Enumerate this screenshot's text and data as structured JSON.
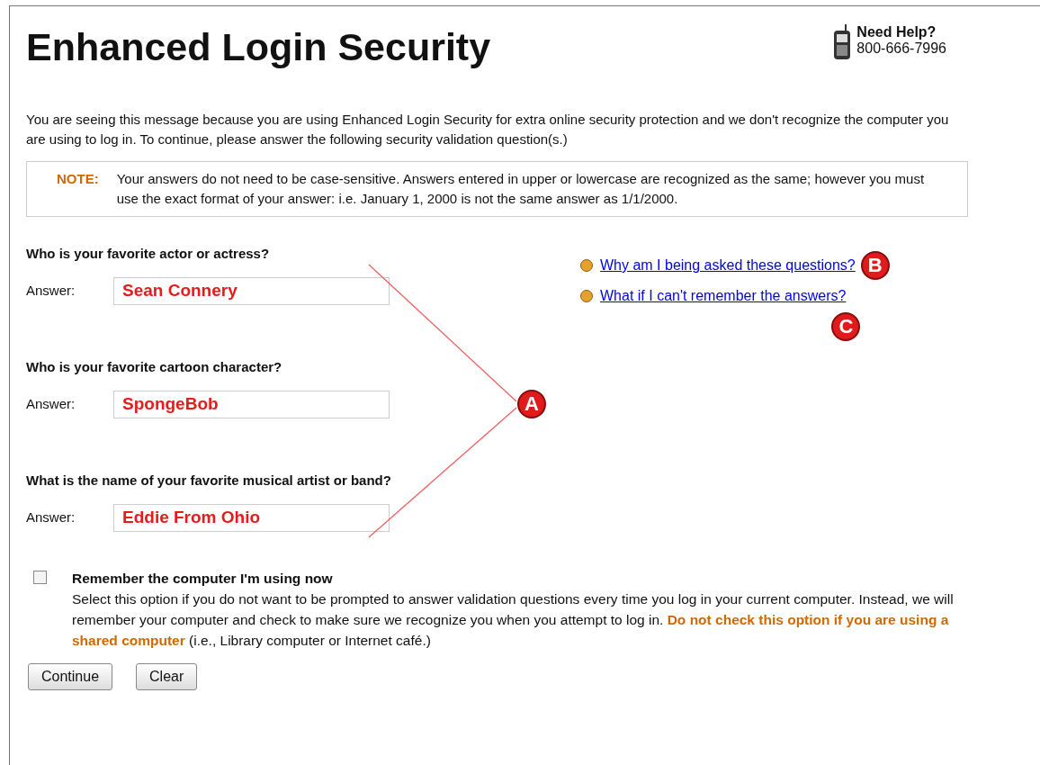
{
  "header": {
    "title": "Enhanced Login Security",
    "help_label": "Need Help?",
    "help_phone": "800-666-7996"
  },
  "intro": "You are seeing this message because you are using Enhanced Login Security for extra online security protection and we don't recognize the computer you are using to log in. To continue, please answer the following security validation question(s.)",
  "note": {
    "label": "NOTE:",
    "text": "Your answers do not need to be case-sensitive. Answers entered in upper or lowercase are recognized as the same; however you must use the exact format of your answer: i.e. January 1, 2000 is not the same answer as 1/1/2000."
  },
  "questions": [
    {
      "question": "Who is your favorite actor or actress?",
      "label": "Answer:",
      "value": "Sean Connery"
    },
    {
      "question": "Who is your favorite cartoon character?",
      "label": "Answer:",
      "value": "SpongeBob"
    },
    {
      "question": "What is the name of your favorite musical artist or band?",
      "label": "Answer:",
      "value": "Eddie From Ohio"
    }
  ],
  "help_links": [
    {
      "text": "Why am I being asked these questions?",
      "callout": "B"
    },
    {
      "text": "What if I can't remember the answers?",
      "callout": "C"
    }
  ],
  "callout": "A",
  "remember": {
    "checked": false,
    "title": "Remember the computer I'm using now",
    "text_before": "Select this option if you do not want to be prompted to answer validation questions every time you log in your current computer. Instead, we will remember your computer and check to make sure we recognize you when you attempt to log in.",
    "warning": "Do not check this option if you are using a shared computer",
    "text_after": "(i.e., Library computer or Internet café.)"
  },
  "buttons": [
    "Continue",
    "Clear"
  ]
}
